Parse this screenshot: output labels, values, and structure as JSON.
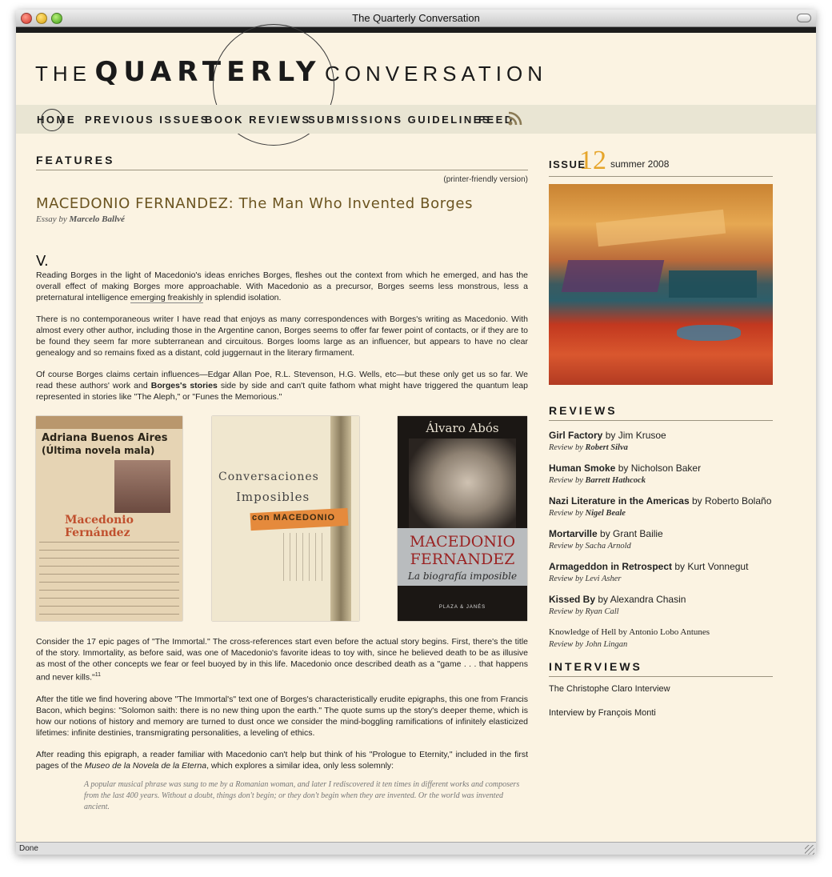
{
  "window": {
    "title": "The Quarterly Conversation",
    "status": "Done"
  },
  "logo": {
    "the": "THE",
    "quarterly": "QUARTERLY",
    "conversation": "CONVERSATION"
  },
  "nav": {
    "home": "HOME",
    "previous": "PREVIOUS ISSUES",
    "reviews": "BOOK REVIEWS",
    "submissions": "SUBMISSIONS GUIDELINES",
    "feed": "FEED"
  },
  "features": {
    "heading": "FEATURES",
    "printer": "(printer-friendly version)",
    "title": "MACEDONIO FERNANDEZ: The Man Who Invented Borges",
    "byline_prefix": "Essay by",
    "author": "Marcelo Ballvé",
    "section": "V.",
    "p1_a": "Reading Borges in the light of Macedonio's ideas enriches Borges, fleshes out the context from which he emerged, and has the overall effect of making Borges more approachable. With Macedonio as a precursor, Borges seems less monstrous, less a preternatural intelligence ",
    "p1_link": "emerging freakishly",
    "p1_b": " in splendid isolation.",
    "p2": "There is no contemporaneous writer I have read that enjoys as many correspondences with Borges's writing as Macedonio. With almost every other author, including those in the Argentine canon, Borges seems to offer far fewer point of contacts, or if they are to be found they seem far more subterranean and circuitous. Borges looms large as an influencer, but appears to have no clear genealogy and so remains fixed as a distant, cold juggernaut in the literary firmament.",
    "p3_a": "Of course Borges claims certain influences—Edgar Allan Poe, R.L. Stevenson, H.G. Wells, etc—but these only get us so far. We read these authors' work and ",
    "p3_bold": "Borges's stories",
    "p3_b": " side by side and can't quite fathom what might have triggered the quantum leap represented in stories like \"The Aleph,\" or \"Funes the Memorious.\"",
    "p4": "Consider the 17 epic pages of \"The Immortal.\" The cross-references start even before the actual story begins. First, there's the title of the story. Immortality, as before said, was one of Macedonio's favorite ideas to toy with, since he believed death to be as illusive as most of the other concepts we fear or feel buoyed by in this life. Macedonio once described death as a \"game . . . that happens and never kills.\"",
    "p4_sup": "11",
    "p5": "After the title we find hovering above \"The Immortal's\" text one of Borges's characteristically erudite epigraphs, this one from Francis Bacon, which begins: \"Solomon saith: there is no new thing upon the earth.\" The quote sums up the story's deeper theme, which is how our notions of history and memory are turned to dust once we consider the mind-boggling ramifications of infinitely elasticized lifetimes: infinite destinies, transmigrating personalities, a leveling of ethics.",
    "p6_a": "After reading this epigraph, a reader familiar with Macedonio can't help but think of his \"Prologue to Eternity,\" included in the first pages of the ",
    "p6_em": "Museo de la Novela de la Eterna",
    "p6_b": ", which explores a similar idea, only less solemnly:",
    "quote": "A popular musical phrase was sung to me by a Romanian woman, and later I rediscovered it ten times in different works and composers from the last 400 years. Without a doubt, things don't begin; or they don't begin when they are invented. Or the world was invented ancient."
  },
  "covers": [
    {
      "line1": "Adriana Buenos Aires",
      "line2": "(Última novela mala)",
      "name": "Macedonio Fernández"
    },
    {
      "line1": "Conversaciones",
      "line2": "Imposibles",
      "band": "con MACEDONIO"
    },
    {
      "author": "Álvaro Abós",
      "name1": "MACEDONIO",
      "name2": "FERNANDEZ",
      "subtitle": "La biografía imposible",
      "publisher": "PLAZA & JANÉS"
    }
  ],
  "sidebar": {
    "issue_label": "ISSUE",
    "issue_number": "12",
    "issue_season": "summer 2008",
    "reviews_heading": "REVIEWS",
    "reviews": [
      {
        "title": "Girl Factory",
        "by": "by Jim Krusoe",
        "reviewer_prefix": "Review by",
        "reviewer": "Robert Silva",
        "reviewer_bold": true
      },
      {
        "title": "Human Smoke",
        "by": "by Nicholson Baker",
        "reviewer_prefix": "Review by",
        "reviewer": "Barrett Hathcock",
        "reviewer_bold": true
      },
      {
        "title": "Nazi Literature in the Americas",
        "by": "by Roberto Bolaño",
        "reviewer_prefix": "Review by",
        "reviewer": "Nigel Beale",
        "reviewer_bold": true
      },
      {
        "title": "Mortarville",
        "by": "by Grant Bailie",
        "reviewer_prefix": "Review by",
        "reviewer": "Sacha Arnold",
        "reviewer_bold": false
      },
      {
        "title": "Armageddon in Retrospect",
        "by": "by Kurt Vonnegut",
        "reviewer_prefix": "Review by",
        "reviewer": "Levi Asher",
        "reviewer_bold": false
      },
      {
        "title": "Kissed By",
        "by": "by Alexandra Chasin",
        "reviewer_prefix": "Review by",
        "reviewer": "Ryan Call",
        "reviewer_bold": false
      }
    ],
    "extra_review": {
      "title": "Knowledge of Hell by Antonio Lobo Antunes",
      "reviewer_prefix": "Review by",
      "reviewer": "John Lingan"
    },
    "interviews_heading": "INTERVIEWS",
    "interviews": [
      "The Christophe Claro Interview",
      "Interview by François Monti"
    ]
  },
  "colors": {
    "background": "#fbf3e2",
    "nav": "#e9e5d3",
    "title": "#6b5420",
    "issue_number": "#e6a52a"
  }
}
